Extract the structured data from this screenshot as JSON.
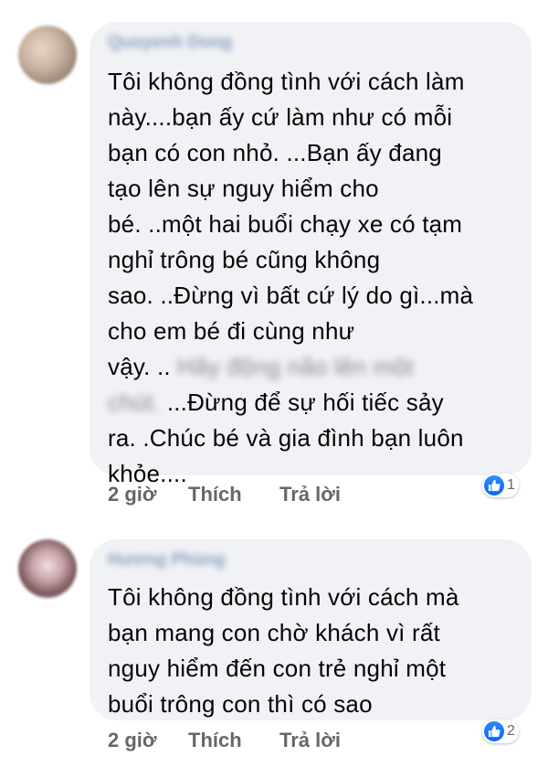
{
  "comments": [
    {
      "author": "Quoyenh Dong",
      "lines_before": [
        "Tôi không đồng tình với cách làm",
        "này....bạn ấy cứ làm như có mỗi",
        "bạn có con nhỏ. ...Bạn ấy đang",
        "tạo lên sự nguy hiểm cho",
        "bé. ..một hai buổi chạy xe có tạm",
        "nghỉ trông bé cũng không",
        "sao. ..Đừng vì bất cứ lý do gì...mà",
        "cho em bé đi cùng như"
      ],
      "line9_visible": "vậy. ..",
      "line9_blurred": "Hãy động não lên một",
      "line10_blurred": "chút.",
      "line10_visible": "...Đừng để sự hối tiếc sảy",
      "lines_after": [
        "ra. .Chúc bé và gia đình bạn luôn",
        "khỏe...."
      ],
      "time": "2 giờ",
      "like_label": "Thích",
      "reply_label": "Trả lời",
      "reaction_count": "1"
    },
    {
      "author": "Hương Phùng",
      "lines": [
        "Tôi không đồng tình với cách mà",
        "bạn mang con chờ khách vì rất",
        "nguy hiểm đến con trẻ nghỉ một",
        "buổi trông con thì có sao"
      ],
      "time": "2 giờ",
      "like_label": "Thích",
      "reply_label": "Trả lời",
      "reaction_count": "2"
    }
  ],
  "colors": {
    "bubble": "#f0f2f5",
    "author": "#385898",
    "text": "#050505",
    "meta": "#65676b",
    "like": "#0866ff"
  },
  "icons": {
    "avatar": "user-avatar",
    "reaction": "like-thumb-icon"
  }
}
